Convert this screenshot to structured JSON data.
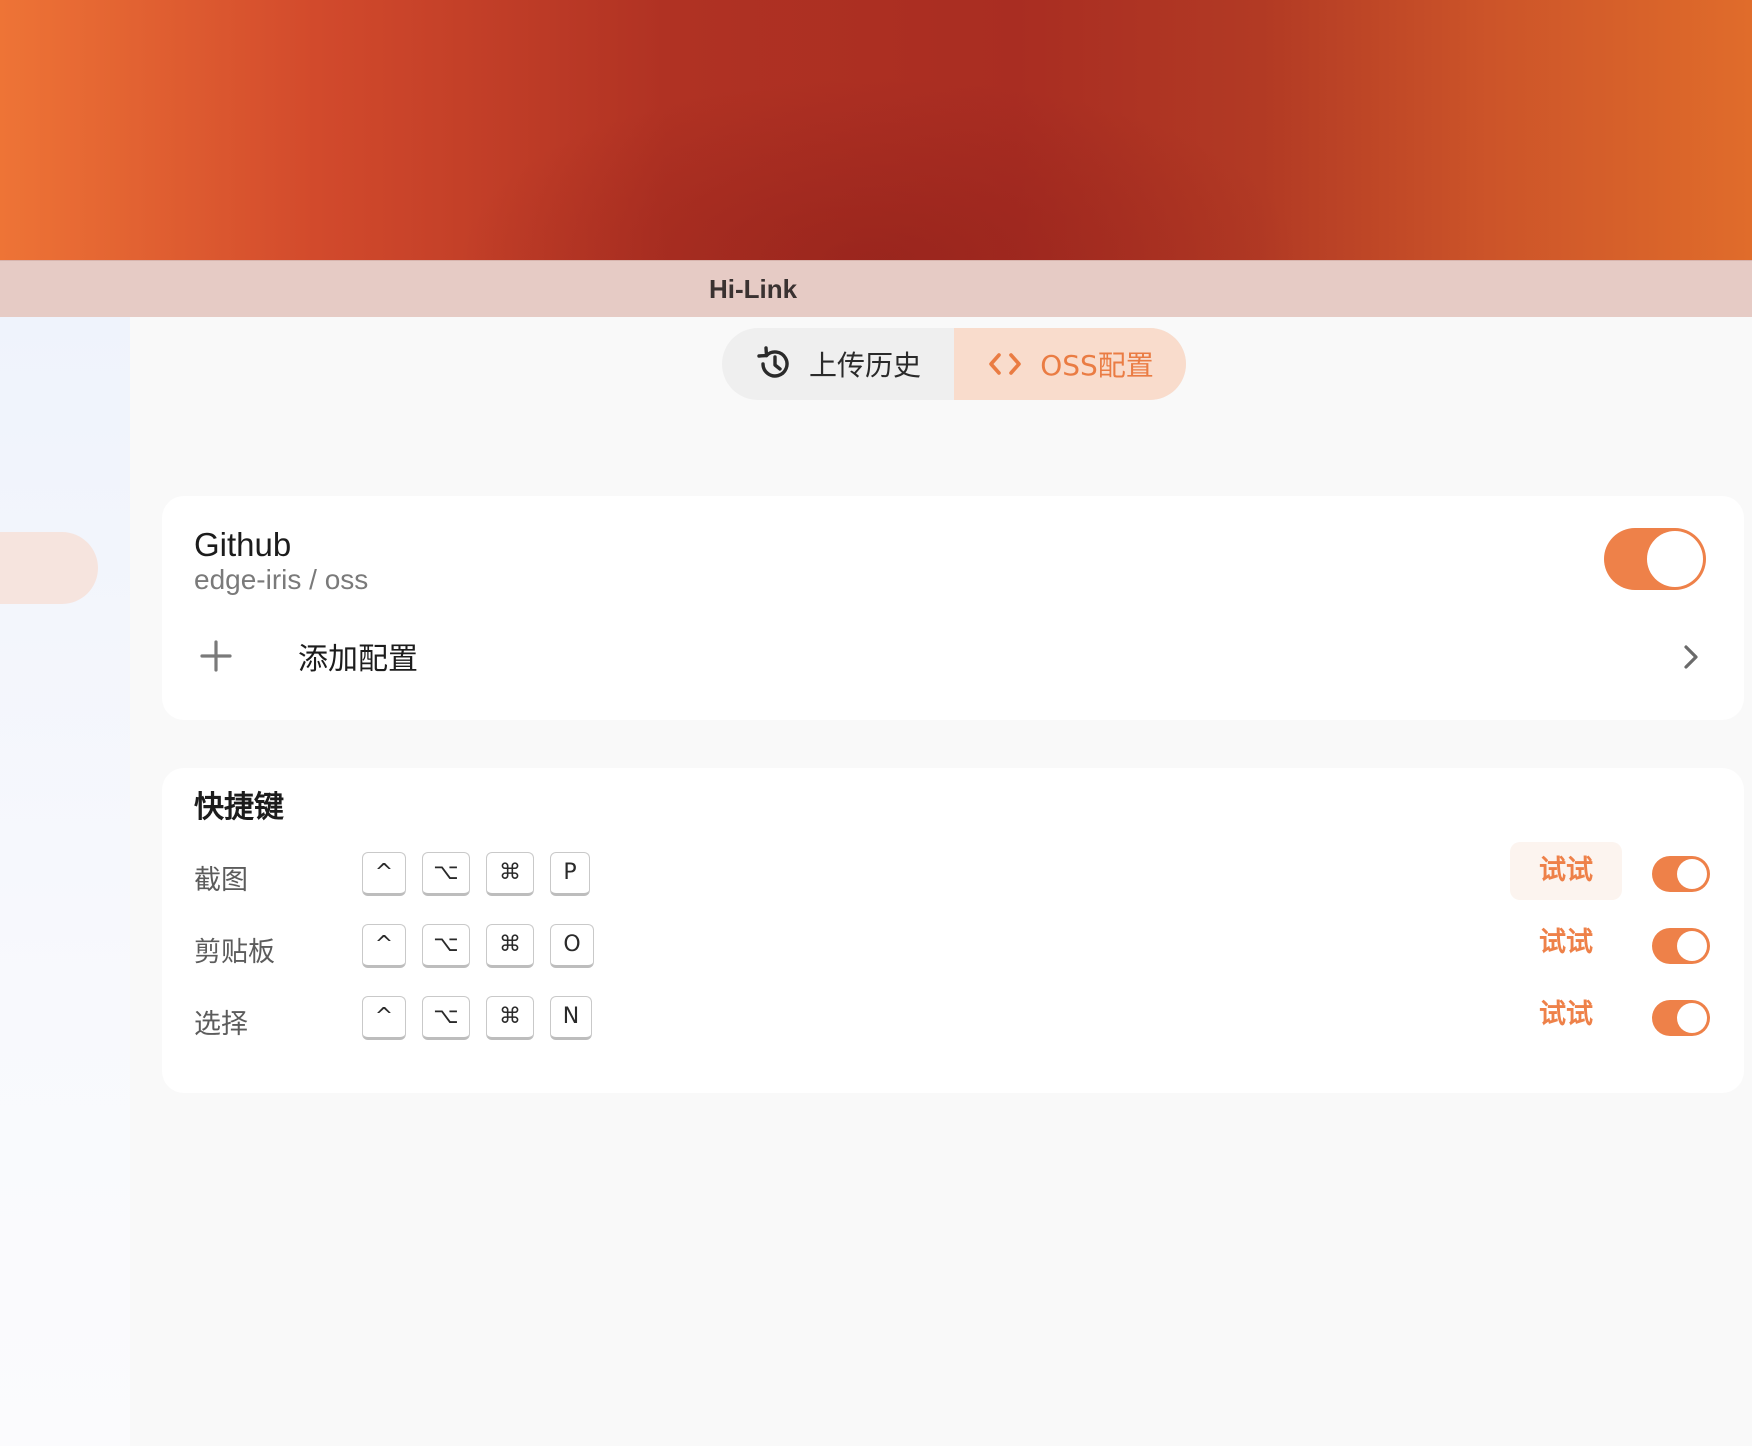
{
  "window": {
    "title": "Hi-Link"
  },
  "tabs": [
    {
      "label": "上传历史",
      "icon": "history-icon",
      "active": false
    },
    {
      "label": "OSS配置",
      "icon": "code-icon",
      "active": true
    }
  ],
  "oss": {
    "provider": "Github",
    "repo": "edge-iris / oss",
    "enabled": true,
    "add_label": "添加配置"
  },
  "shortcuts": {
    "title": "快捷键",
    "try_label": "试试",
    "rows": [
      {
        "label": "截图",
        "keys": [
          "^",
          "⌥",
          "⌘",
          "P"
        ],
        "enabled": true
      },
      {
        "label": "剪贴板",
        "keys": [
          "^",
          "⌥",
          "⌘",
          "O"
        ],
        "enabled": true
      },
      {
        "label": "选择",
        "keys": [
          "^",
          "⌥",
          "⌘",
          "N"
        ],
        "enabled": true
      }
    ]
  },
  "colors": {
    "accent": "#ee8149",
    "active_tab_bg": "#f9dccc",
    "titlebar_bg": "#e6cbc5"
  }
}
